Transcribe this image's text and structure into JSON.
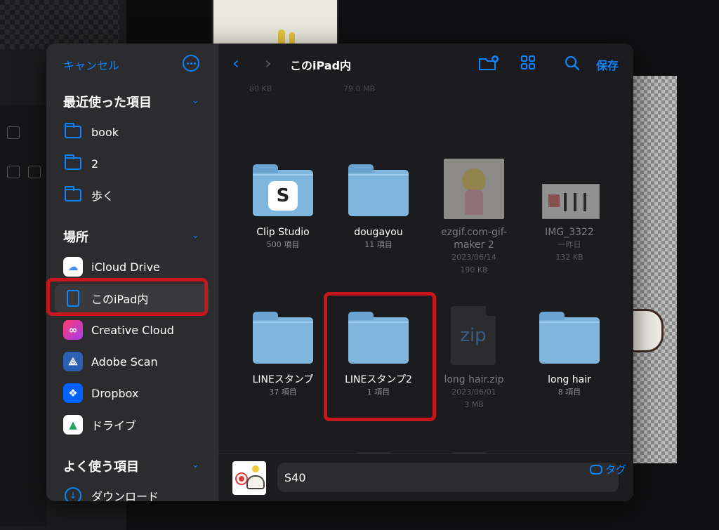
{
  "sidebar": {
    "cancel": "キャンセル",
    "recent": {
      "title": "最近使った項目",
      "items": [
        "book",
        "2",
        "歩く"
      ]
    },
    "places": {
      "title": "場所",
      "items": [
        {
          "label": "iCloud Drive",
          "icon": "icloud-icon"
        },
        {
          "label": "このiPad内",
          "icon": "ipad-icon",
          "selected": true
        },
        {
          "label": "Creative Cloud",
          "icon": "creative-cloud-icon"
        },
        {
          "label": "Adobe Scan",
          "icon": "adobe-scan-icon"
        },
        {
          "label": "Dropbox",
          "icon": "dropbox-icon"
        },
        {
          "label": "ドライブ",
          "icon": "google-drive-icon"
        }
      ]
    },
    "favorites": {
      "title": "よく使う項目",
      "items": [
        "ダウンロード"
      ]
    }
  },
  "toolbar": {
    "title": "このiPad内",
    "save": "保存"
  },
  "ghost_row": [
    "80 KB",
    "79.0 MB"
  ],
  "files": [
    {
      "name": "Clip Studio",
      "meta": [
        "500 項目"
      ],
      "kind": "folder-app"
    },
    {
      "name": "dougayou",
      "meta": [
        "11 項目"
      ],
      "kind": "folder"
    },
    {
      "name": "ezgif.com-gif-maker 2",
      "meta": [
        "2023/06/14",
        "190 KB"
      ],
      "kind": "image"
    },
    {
      "name": "IMG_3322",
      "meta": [
        "一昨日",
        "132 KB"
      ],
      "kind": "image"
    },
    {
      "name": "LINEスタンプ",
      "meta": [
        "37 項目"
      ],
      "kind": "folder"
    },
    {
      "name": "LINEスタンプ2",
      "meta": [
        "1 項目"
      ],
      "kind": "folder"
    },
    {
      "name": "long hair.zip",
      "meta": [
        "2023/06/01",
        "3 MB"
      ],
      "kind": "zip"
    },
    {
      "name": "long hair",
      "meta": [
        "8 項目"
      ],
      "kind": "folder"
    }
  ],
  "bottom": {
    "filename": "S40",
    "tag": "タグ"
  },
  "colors": {
    "accent": "#0a84ff",
    "highlight": "#c8161d",
    "folder": "#7fb6de"
  }
}
